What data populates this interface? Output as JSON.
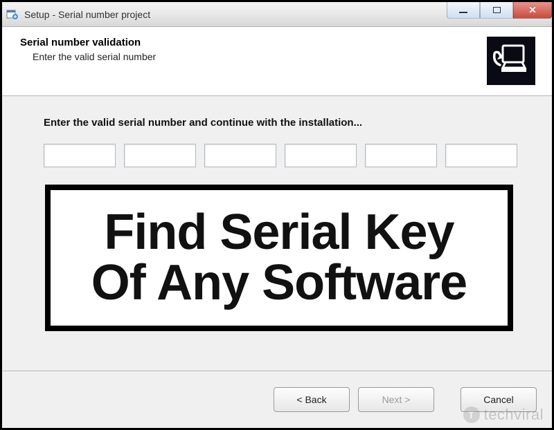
{
  "titlebar": {
    "title": "Setup - Serial number project"
  },
  "header": {
    "heading": "Serial number validation",
    "subheading": "Enter the valid serial number"
  },
  "body": {
    "instruction": "Enter the valid serial number and continue with the installation...",
    "serial_fields": [
      "",
      "",
      "",
      "",
      "",
      ""
    ]
  },
  "overlay": {
    "line1": "Find Serial Key",
    "line2": "Of Any Software"
  },
  "footer": {
    "back_label": "< Back",
    "next_label": "Next >",
    "cancel_label": "Cancel"
  },
  "watermark": {
    "text": "techviral"
  }
}
